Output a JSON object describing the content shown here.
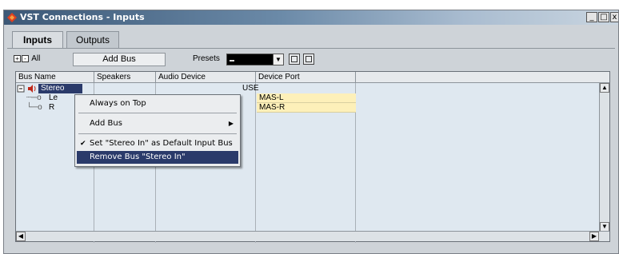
{
  "window": {
    "title": "VST Connections - Inputs",
    "buttons": {
      "minimize": "_",
      "maximize": "□",
      "close": "x"
    }
  },
  "tabs": [
    {
      "label": "Inputs",
      "active": true
    },
    {
      "label": "Outputs",
      "active": false
    }
  ],
  "toolbar": {
    "expand_all": "+",
    "collapse_all": "-",
    "all_label": "All",
    "add_bus_label": "Add Bus",
    "presets_label": "Presets"
  },
  "table": {
    "columns": [
      "Bus Name",
      "Speakers",
      "Audio Device",
      "Device Port"
    ],
    "bus_name": "Stereo",
    "audio_device_partial": "USE",
    "rows": [
      {
        "bus": "Le",
        "port": "MAS-L"
      },
      {
        "bus": "R",
        "port": "MAS-R"
      }
    ]
  },
  "context_menu": {
    "items": [
      {
        "label": "Always on Top",
        "checked": false,
        "submenu": false,
        "highlighted": false
      },
      {
        "label": "Add Bus",
        "checked": false,
        "submenu": true,
        "highlighted": false
      },
      {
        "label": "Set \"Stereo In\" as Default Input Bus",
        "checked": true,
        "submenu": false,
        "highlighted": false
      },
      {
        "label": "Remove Bus \"Stereo In\"",
        "checked": false,
        "submenu": false,
        "highlighted": true
      }
    ]
  },
  "colors": {
    "title_gradient_start": "#3c5877",
    "highlight": "#2a3a6a",
    "port_cell": "#fdf0b9"
  }
}
